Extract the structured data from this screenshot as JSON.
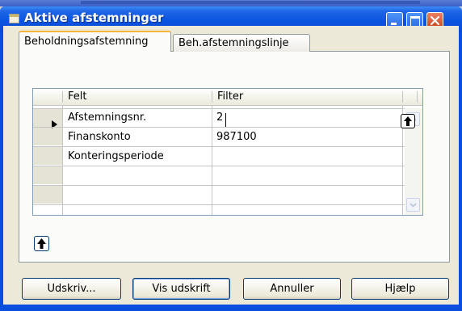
{
  "window": {
    "title": "Aktive afstemninger"
  },
  "tabs": [
    {
      "label": "Beholdningsafstemning",
      "active": true
    },
    {
      "label": "Beh.afstemningslinje",
      "active": false
    }
  ],
  "grid": {
    "columns": [
      "Felt",
      "Filter"
    ],
    "rows": [
      {
        "field": "Afstemningsnr.",
        "filter": "2"
      },
      {
        "field": "Finanskonto",
        "filter": "987100"
      },
      {
        "field": "Konteringsperiode",
        "filter": ""
      },
      {
        "field": "",
        "filter": ""
      },
      {
        "field": "",
        "filter": ""
      }
    ]
  },
  "buttons": {
    "print": "Udskriv...",
    "preview": "Vis udskrift",
    "cancel": "Annuller",
    "help": "Hjælp"
  },
  "icons": {
    "window": "form-icon",
    "lookup": "arrow-up-icon",
    "minimize": "minimize-icon",
    "maximize": "maximize-icon",
    "close": "close-icon"
  },
  "colors": {
    "titlebar": "#0a4ee0",
    "client": "#ece9d8",
    "tab_highlight": "#f5b53c"
  }
}
